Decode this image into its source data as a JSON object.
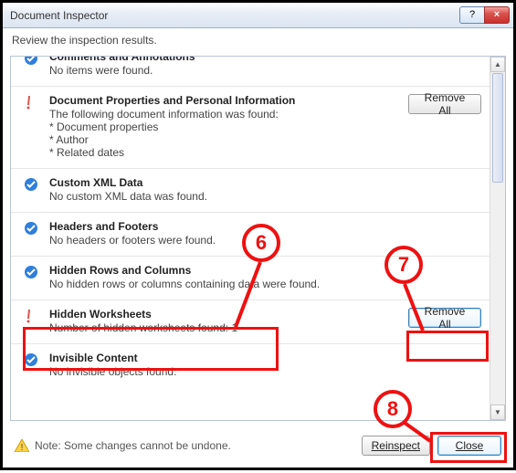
{
  "window": {
    "title": "Document Inspector",
    "help": "?",
    "close": "×"
  },
  "instructions": "Review the inspection results.",
  "sections": [
    {
      "status": "ok",
      "title": "Comments and Annotations",
      "body": "No items were found."
    },
    {
      "status": "warn",
      "title": "Document Properties and Personal Information",
      "body": "The following document information was found:\n* Document properties\n* Author\n* Related dates",
      "button": "Remove All"
    },
    {
      "status": "ok",
      "title": "Custom XML Data",
      "body": "No custom XML data was found."
    },
    {
      "status": "ok",
      "title": "Headers and Footers",
      "body": "No headers or footers were found."
    },
    {
      "status": "ok",
      "title": "Hidden Rows and Columns",
      "body": "No hidden rows or columns containing data were found."
    },
    {
      "status": "warn",
      "title": "Hidden Worksheets",
      "body": "Number of hidden worksheets found: 1",
      "button": "Remove All"
    },
    {
      "status": "ok",
      "title": "Invisible Content",
      "body": "No invisible objects found."
    }
  ],
  "footer": {
    "note": "Note: Some changes cannot be undone.",
    "reinspect": "Reinspect",
    "close": "Close"
  },
  "annotations": {
    "6": "6",
    "7": "7",
    "8": "8"
  }
}
